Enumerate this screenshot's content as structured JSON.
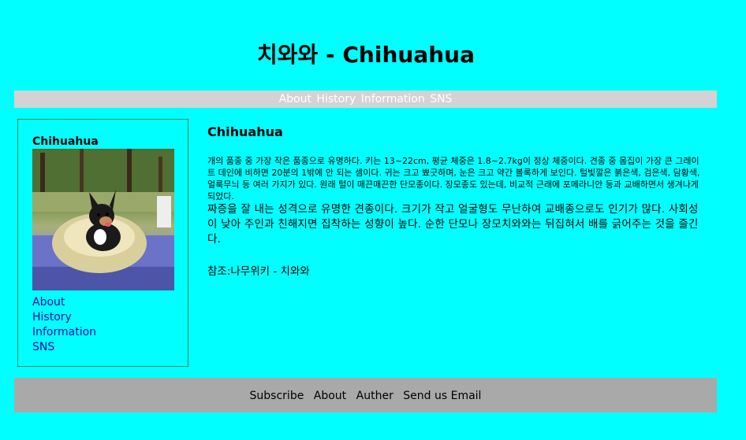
{
  "page": {
    "title": "치와와 - Chihuahua"
  },
  "nav": {
    "items": [
      "About",
      "History",
      "Information",
      "SNS"
    ]
  },
  "sidebar": {
    "title": "Chihuahua",
    "links": [
      "About",
      "History",
      "Information",
      "SNS"
    ]
  },
  "main": {
    "heading": "Chihuahua",
    "paragraph1": "개의 품종 중 가장 작은 품종으로 유명하다. 키는 13~22cm, 평균 체중은 1.8~2.7kg이 정상 체중이다. 견종 중 몸집이 가장 큰 그레이트 데인에 비하면 20분의 1밖에 안 되는 셈이다. 귀는 크고 뾰긋하며, 눈은 크고 약간 볼록하게 보인다. 털빛깔은 붉은색, 검은색, 담황색, 얼룩무늬 등 여러 가지가 있다. 원래 털이 매끈매끈한 단모종이다. 장모종도 있는데, 비교적 근래에 포메라니안 등과 교배하면서 생겨나게 되었다.",
    "paragraph2": "짜증을 잘 내는 성격으로 유명한 견종이다. 크기가 작고 얼굴형도 무난하여 교배종으로도 인기가 많다. 사회성이 낮아 주인과 친해지면 집착하는 성향이 높다. 순한 단모나 장모치와와는 뒤집혀서 배를 긁어주는 것을 즐긴다.",
    "reference": "참조:나무위키 - 치와와"
  },
  "footer": {
    "items": [
      "Subscribe",
      "About",
      "Auther",
      "Send us Email"
    ]
  },
  "colors": {
    "background": "#00ffff",
    "nav": "#d3d3d3",
    "footer": "#a9a9a9",
    "sidebar_border": "#2e8b57"
  }
}
